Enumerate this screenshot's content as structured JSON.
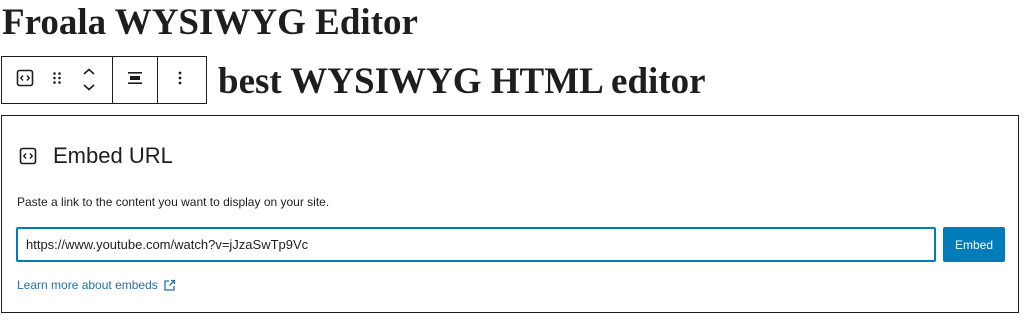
{
  "heading": "Froala WYSIWYG Editor",
  "toolbar": {
    "buttons": [
      {
        "icon": "embed-block-icon"
      },
      {
        "icon": "drag-handle-icon"
      },
      {
        "icon": "move-up-down-icon"
      },
      {
        "icon": "align-icon"
      },
      {
        "icon": "more-options-icon"
      }
    ]
  },
  "subheading": "best WYSIWYG HTML editor",
  "embed": {
    "title": "Embed URL",
    "instructions": "Paste a link to the content you want to display on your site.",
    "url_value": "https://www.youtube.com/watch?v=jJzaSwTp9Vc",
    "button_label": "Embed",
    "learn_more": "Learn more about embeds"
  },
  "colors": {
    "accent": "#007cba",
    "link": "#2271b1",
    "text": "#1e1e1e"
  }
}
